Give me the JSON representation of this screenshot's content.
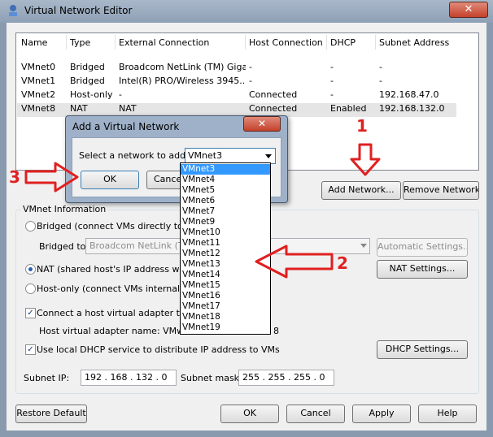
{
  "window": {
    "title": "Virtual Network Editor",
    "close_glyph": "✕"
  },
  "networks": {
    "headers": [
      "Name",
      "Type",
      "External Connection",
      "Host Connection",
      "DHCP",
      "Subnet Address"
    ],
    "rows": [
      [
        "VMnet0",
        "Bridged",
        "Broadcom NetLink (TM) Giga...",
        "-",
        "-",
        "-"
      ],
      [
        "VMnet1",
        "Bridged",
        "Intel(R) PRO/Wireless 3945...",
        "-",
        "-",
        "-"
      ],
      [
        "VMnet2",
        "Host-only",
        "-",
        "Connected",
        "-",
        "192.168.47.0"
      ],
      [
        "VMnet8",
        "NAT",
        "NAT",
        "Connected",
        "Enabled",
        "192.168.132.0"
      ]
    ]
  },
  "buttons": {
    "add_network": "Add Network...",
    "remove_network": "Remove Network",
    "automatic_settings": "Automatic Settings...",
    "nat_settings": "NAT Settings...",
    "dhcp_settings": "DHCP Settings...",
    "restore_default": "Restore Default",
    "ok": "OK",
    "cancel": "Cancel",
    "apply": "Apply",
    "help": "Help"
  },
  "vmnet_info": {
    "group_label": "VMnet Information",
    "bridged_label": "Bridged (connect VMs directly to the",
    "bridged_to_label": "Bridged to:",
    "bridged_to_value": "Broadcom NetLink (TM)",
    "nat_label": "NAT (shared host's IP address with V",
    "hostonly_label": "Host-only (connect VMs internally in a",
    "connect_adapter_label": "Connect a host virtual adapter to thi",
    "adapter_name_prefix": "Host virtual adapter name: VMware",
    "adapter_name_suffix": "8",
    "dhcp_label": "Use local DHCP service to distribute IP address to VMs",
    "subnet_ip_label": "Subnet IP:",
    "subnet_ip": "192 . 168 . 132 .  0",
    "subnet_mask_label": "Subnet mask:",
    "subnet_mask": "255 . 255 . 255 .  0"
  },
  "dialog": {
    "title": "Add a Virtual Network",
    "close_glyph": "✕",
    "select_label": "Select a network to add:",
    "selected": "VMnet3",
    "ok": "OK",
    "cancel": "Cancel",
    "options": [
      "VMnet3",
      "VMnet4",
      "VMnet5",
      "VMnet6",
      "VMnet7",
      "VMnet9",
      "VMnet10",
      "VMnet11",
      "VMnet12",
      "VMnet13",
      "VMnet14",
      "VMnet15",
      "VMnet16",
      "VMnet17",
      "VMnet18",
      "VMnet19"
    ]
  },
  "annotations": {
    "one": "1",
    "two": "2",
    "three": "3",
    "color": "#e02020"
  }
}
